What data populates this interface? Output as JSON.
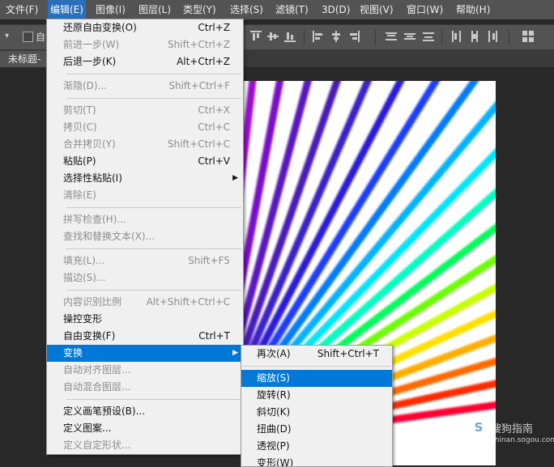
{
  "menubar": {
    "items": [
      "文件(F)",
      "编辑(E)",
      "图像(I)",
      "图层(L)",
      "类型(Y)",
      "选择(S)",
      "滤镜(T)",
      "3D(D)",
      "视图(V)",
      "窗口(W)",
      "帮助(H)"
    ],
    "active": "编辑(E)"
  },
  "options_bar": {
    "checkbox_label": "自"
  },
  "document": {
    "tab_label": "未标题-"
  },
  "edit_menu": {
    "items": [
      {
        "label": "还原自由变换(O)",
        "shortcut": "Ctrl+Z",
        "enabled": true
      },
      {
        "label": "前进一步(W)",
        "shortcut": "Shift+Ctrl+Z",
        "enabled": false
      },
      {
        "label": "后退一步(K)",
        "shortcut": "Alt+Ctrl+Z",
        "enabled": true
      },
      {
        "label": "渐隐(D)...",
        "shortcut": "Shift+Ctrl+F",
        "enabled": false
      },
      {
        "label": "剪切(T)",
        "shortcut": "Ctrl+X",
        "enabled": false
      },
      {
        "label": "拷贝(C)",
        "shortcut": "Ctrl+C",
        "enabled": false
      },
      {
        "label": "合并拷贝(Y)",
        "shortcut": "Shift+Ctrl+C",
        "enabled": false
      },
      {
        "label": "粘贴(P)",
        "shortcut": "Ctrl+V",
        "enabled": true
      },
      {
        "label": "选择性粘贴(I)",
        "shortcut": "",
        "enabled": true,
        "submenu": true
      },
      {
        "label": "清除(E)",
        "shortcut": "",
        "enabled": false
      },
      {
        "label": "拼写检查(H)...",
        "shortcut": "",
        "enabled": false
      },
      {
        "label": "查找和替换文本(X)...",
        "shortcut": "",
        "enabled": false
      },
      {
        "label": "填充(L)...",
        "shortcut": "Shift+F5",
        "enabled": false
      },
      {
        "label": "描边(S)...",
        "shortcut": "",
        "enabled": false
      },
      {
        "label": "内容识别比例",
        "shortcut": "Alt+Shift+Ctrl+C",
        "enabled": false
      },
      {
        "label": "操控变形",
        "shortcut": "",
        "enabled": true
      },
      {
        "label": "自由变换(F)",
        "shortcut": "Ctrl+T",
        "enabled": true
      },
      {
        "label": "变换",
        "shortcut": "",
        "enabled": true,
        "submenu": true,
        "highlighted": true
      },
      {
        "label": "自动对齐图层...",
        "shortcut": "",
        "enabled": false
      },
      {
        "label": "自动混合图层...",
        "shortcut": "",
        "enabled": false
      },
      {
        "label": "定义画笔预设(B)...",
        "shortcut": "",
        "enabled": true
      },
      {
        "label": "定义图案...",
        "shortcut": "",
        "enabled": true
      },
      {
        "label": "定义自定形状...",
        "shortcut": "",
        "enabled": false
      }
    ]
  },
  "transform_submenu": {
    "items": [
      {
        "label": "再次(A)",
        "shortcut": "Shift+Ctrl+T"
      },
      {
        "label": "缩放(S)",
        "shortcut": "",
        "highlighted": true
      },
      {
        "label": "旋转(R)",
        "shortcut": ""
      },
      {
        "label": "斜切(K)",
        "shortcut": ""
      },
      {
        "label": "扭曲(D)",
        "shortcut": ""
      },
      {
        "label": "透视(P)",
        "shortcut": ""
      },
      {
        "label": "变形(W)",
        "shortcut": ""
      }
    ]
  },
  "watermark": {
    "brand": "搜狗指南",
    "url": "zhinan.sogou.com"
  },
  "colors": {
    "menu_highlight": "#0078d7",
    "menubar_bg": "#535353",
    "menubar_active": "#2a6fba"
  }
}
